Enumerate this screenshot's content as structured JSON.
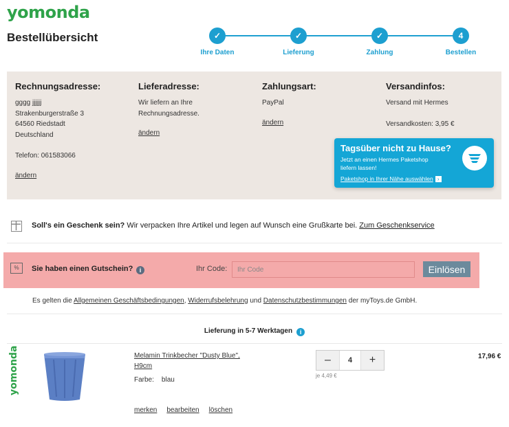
{
  "brand": {
    "logo": "yomonda",
    "vertical": "yomonda",
    "color": "#2fa34a"
  },
  "page": {
    "title": "Bestellübersicht"
  },
  "stepper": {
    "accent": "#1d9fd0",
    "steps": [
      {
        "label": "Ihre Daten",
        "marker": "✓",
        "state": "done"
      },
      {
        "label": "Lieferung",
        "marker": "✓",
        "state": "done"
      },
      {
        "label": "Zahlung",
        "marker": "✓",
        "state": "done"
      },
      {
        "label": "Bestellen",
        "marker": "4",
        "state": "current"
      }
    ]
  },
  "billing": {
    "title": "Rechnungsadresse:",
    "name": "gggg jjjjjj",
    "street": "Strakenburgerstraße 3",
    "city": "64560 Riedstadt",
    "country": "Deutschland",
    "phone": "Telefon: 061583066",
    "edit": "ändern"
  },
  "shipping": {
    "title": "Lieferadresse:",
    "line1": "Wir liefern an Ihre",
    "line2": "Rechnungsadresse.",
    "edit": "ändern"
  },
  "payment": {
    "title": "Zahlungsart:",
    "method": "PayPal",
    "edit": "ändern"
  },
  "delivery_info": {
    "title": "Versandinfos:",
    "carrier": "Versand mit Hermes",
    "cost": "Versandkosten: 3,95 €"
  },
  "hermes_promo": {
    "title": "Tagsüber nicht zu Hause?",
    "line1": "Jetzt an einen Hermes Paketshop",
    "line2": "liefern lassen!",
    "link": "Paketshop in Ihrer Nähe auswählen",
    "icon": "hermes-shop-icon",
    "color": "#14a6d6"
  },
  "gift": {
    "bold": "Soll's ein Geschenk sein?",
    "text": " Wir verpacken Ihre Artikel und legen auf Wunsch eine Grußkarte bei. ",
    "link": "Zum Geschenkservice",
    "icon": "gift-icon"
  },
  "voucher": {
    "icon_text": "%",
    "label": "Sie haben einen Gutschein?",
    "code_label": "Ihr Code:",
    "placeholder": "Ihr Code",
    "button": "Einlösen",
    "highlight": "#f4aaaa"
  },
  "terms": {
    "prefix": "Es gelten die ",
    "agb": "Allgemeinen Geschäftsbedingungen",
    "sep1": ", ",
    "withdrawal": "Widerrufsbelehrung",
    "sep2": " und ",
    "privacy": "Datenschutzbestimmungen",
    "suffix": " der myToys.de GmbH."
  },
  "delivery": {
    "text": "Lieferung in 5-7 Werktagen"
  },
  "product": {
    "name": "Melamin Trinkbecher \"Dusty Blue\", H9cm",
    "color_label": "Farbe:",
    "color_value": "blau",
    "quantity": "4",
    "minus": "–",
    "plus": "+",
    "unit_price": "je 4,49 €",
    "price": "17,96 €",
    "actions": {
      "remember": "merken",
      "edit": "bearbeiten",
      "delete": "löschen"
    }
  }
}
